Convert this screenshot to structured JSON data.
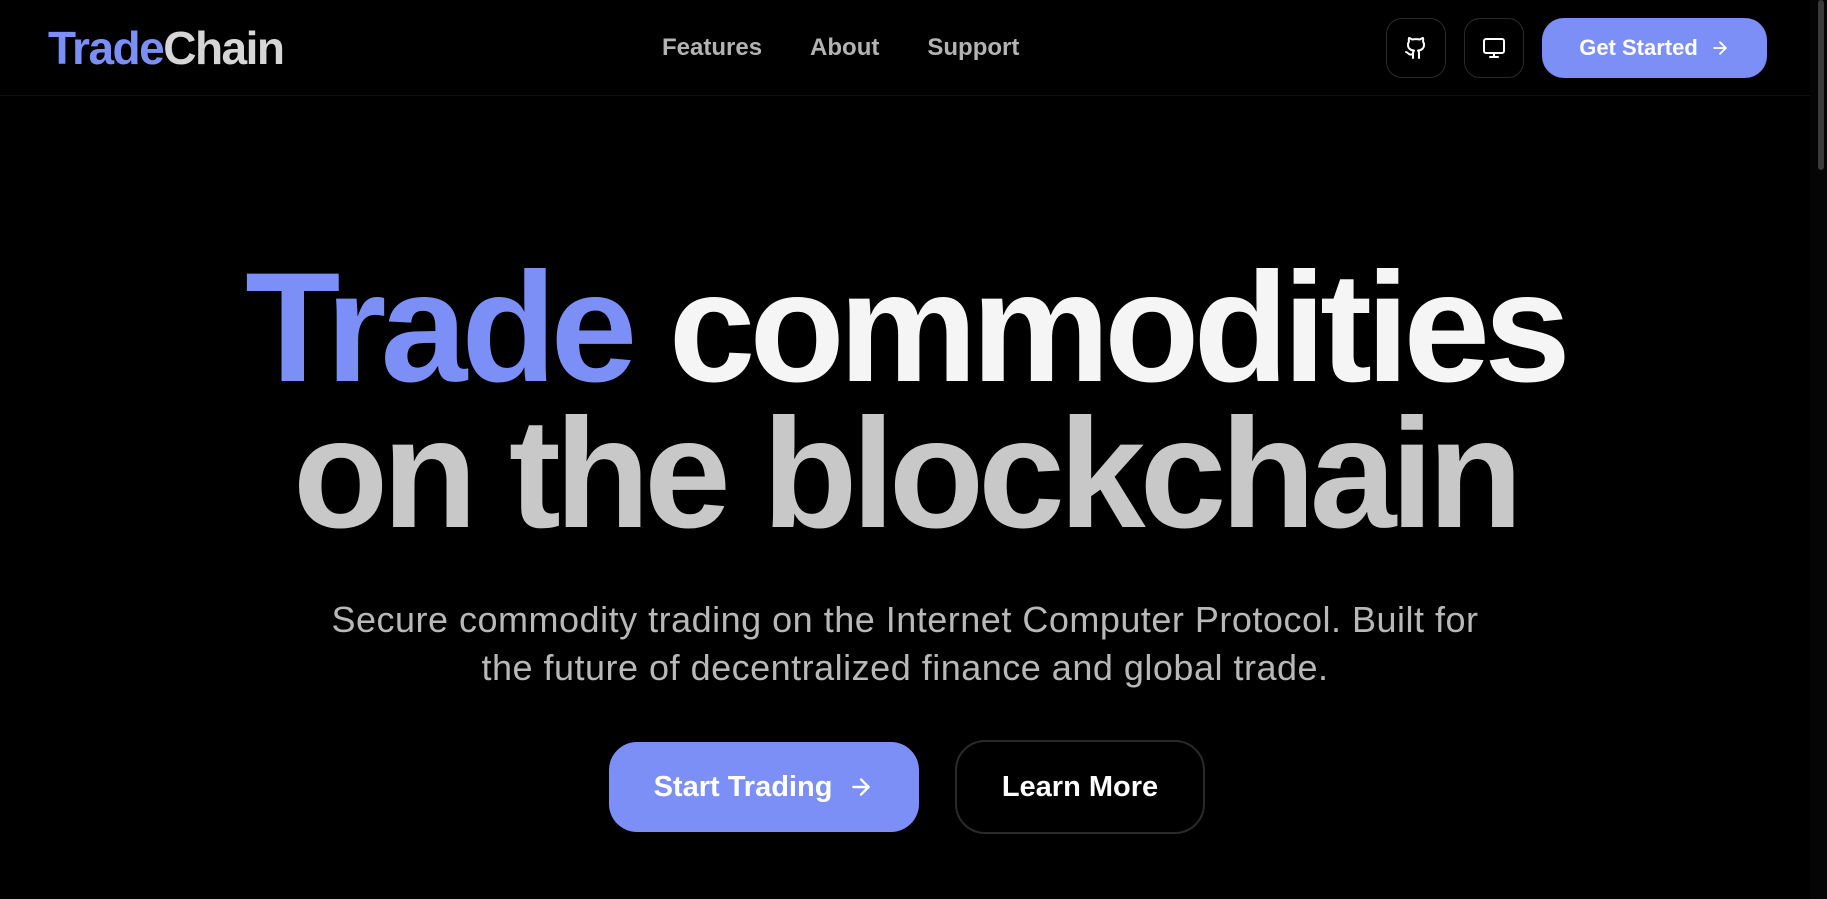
{
  "brand": {
    "accent_part": "Trade",
    "rest_part": "Chain",
    "accent_color": "#7b8ff7"
  },
  "nav": {
    "items": [
      "Features",
      "About",
      "Support"
    ]
  },
  "header_actions": {
    "github_icon": "github-icon",
    "display_icon": "monitor-icon",
    "cta_label": "Get Started",
    "cta_icon": "arrow-right-icon"
  },
  "hero": {
    "title_accent": "Trade",
    "title_line1_rest": "commodities",
    "title_line2": "on the blockchain",
    "subtitle": "Secure commodity trading on the Internet Computer Protocol. Built for the future of decentralized finance and global trade.",
    "primary_button": "Start Trading",
    "secondary_button": "Learn More"
  },
  "colors": {
    "background": "#000000",
    "accent": "#7b8ff7",
    "muted_text": "#b8b8b8"
  }
}
